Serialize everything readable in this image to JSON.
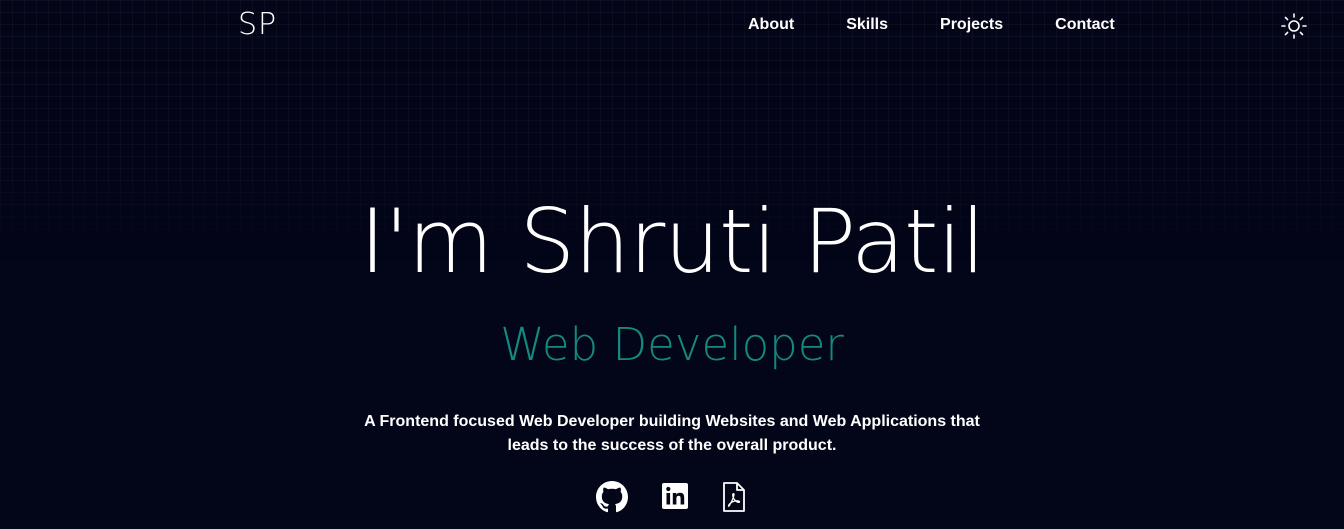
{
  "header": {
    "logo": "SP",
    "nav": [
      {
        "label": "About"
      },
      {
        "label": "Skills"
      },
      {
        "label": "Projects"
      },
      {
        "label": "Contact"
      }
    ],
    "theme_icon": "sun-icon"
  },
  "hero": {
    "title": "I'm Shruti Patil",
    "role": "Web Developer",
    "description": "A Frontend focused Web Developer building Websites and Web Applications that leads to the success of the overall product."
  },
  "socials": [
    {
      "icon": "github-icon"
    },
    {
      "icon": "linkedin-icon"
    },
    {
      "icon": "pdf-resume-icon"
    }
  ],
  "colors": {
    "background": "#030518",
    "accent": "#14897f",
    "text": "#ffffff"
  }
}
